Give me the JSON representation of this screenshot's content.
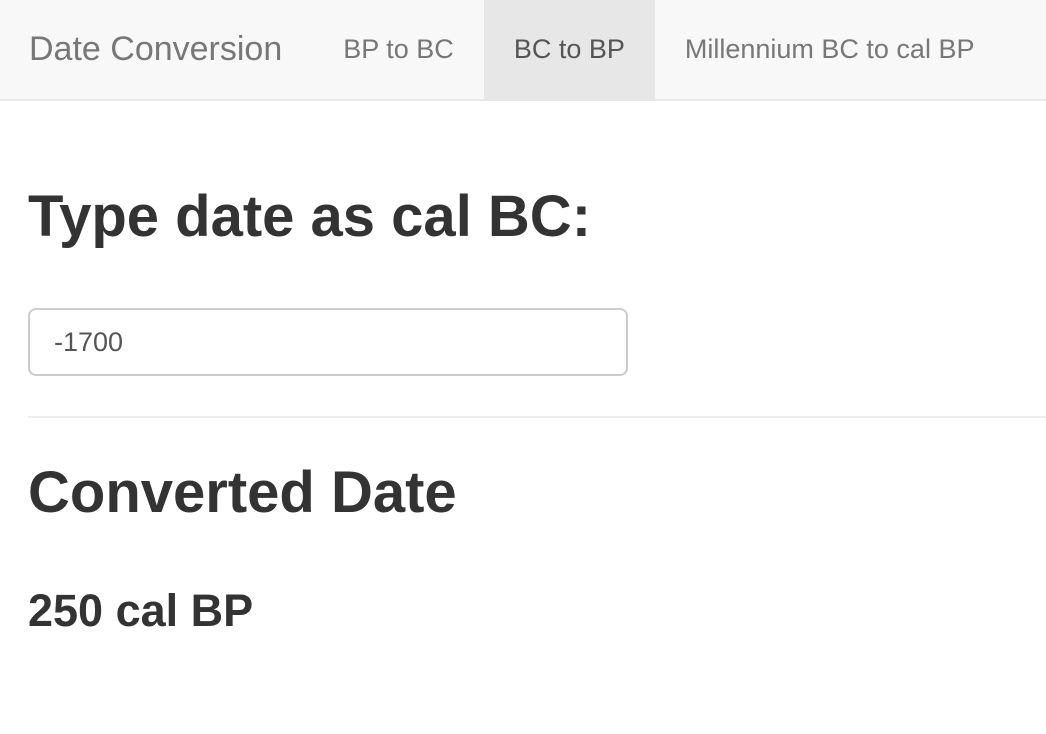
{
  "navbar": {
    "brand": "Date Conversion",
    "tabs": [
      {
        "label": "BP to BC",
        "active": false
      },
      {
        "label": "BC to BP",
        "active": true
      },
      {
        "label": "Millennium BC to cal BP",
        "active": false
      }
    ]
  },
  "form": {
    "label": "Type date as cal BC:",
    "input_value": "-1700"
  },
  "result": {
    "heading": "Converted Date",
    "value": "250 cal BP"
  },
  "colors": {
    "navbar_bg": "#f8f8f8",
    "active_tab_bg": "#e7e7e7",
    "text": "#333333",
    "muted_text": "#777777"
  }
}
